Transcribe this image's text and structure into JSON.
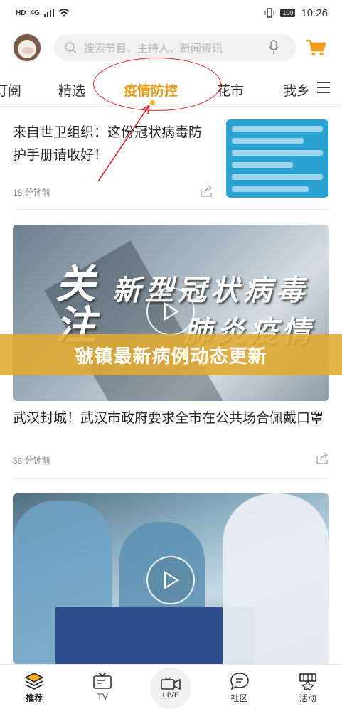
{
  "status_bar": {
    "network_label": "HD",
    "signal_label": "4G",
    "battery_label": "100",
    "time": "10:26"
  },
  "header": {
    "search_placeholder": "搜索节目、主持人、新闻资讯"
  },
  "tabs": [
    {
      "label": "订阅"
    },
    {
      "label": "精选"
    },
    {
      "label": "疫情防控"
    },
    {
      "label": "花市"
    },
    {
      "label": "我乡"
    }
  ],
  "articles": [
    {
      "title": "来自世卫组织：这份冠状病毒防护手册请收好！",
      "time": "18 分钟前"
    },
    {
      "title": "武汉封城！武汉市政府要求全市在公共场合佩戴口罩",
      "time": "56 分钟前",
      "video_caption_big": "关注",
      "video_caption_line1": "新型冠状病毒",
      "video_caption_line2": "肺炎疫情"
    }
  ],
  "overlay_banner": "虢镇最新病例动态更新",
  "bottom_nav": [
    {
      "label": "推荐",
      "icon": "layers-icon"
    },
    {
      "label": "TV",
      "icon": "tv-icon"
    },
    {
      "label": "LIVE",
      "icon": "live-camera-icon"
    },
    {
      "label": "社区",
      "icon": "chat-icon"
    },
    {
      "label": "活动",
      "icon": "activity-icon"
    }
  ],
  "colors": {
    "accent": "#e89b16",
    "annotation": "#d8282d",
    "banner": "#e0aa30"
  }
}
